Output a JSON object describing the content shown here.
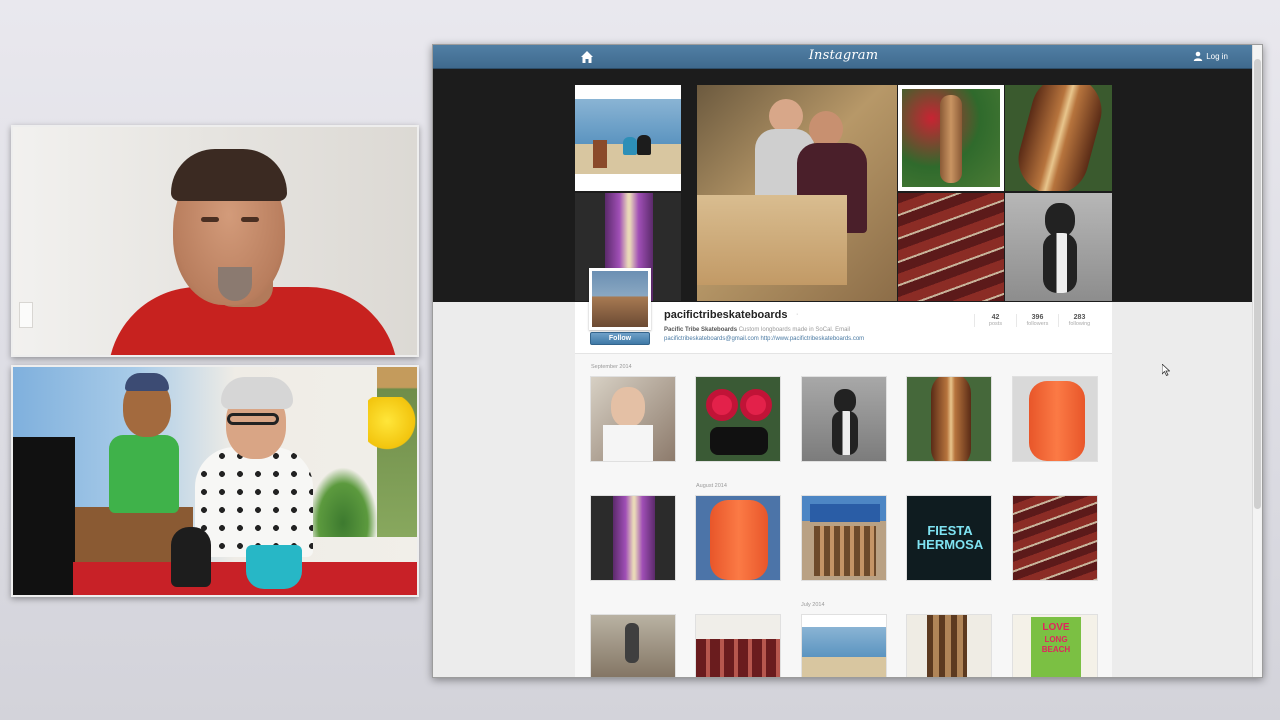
{
  "header": {
    "logo": "Instagram",
    "login_label": "Log in"
  },
  "profile": {
    "username": "pacifictribeskateboards",
    "verified_mark": "·",
    "bio_name": "Pacific Tribe Skateboards",
    "bio_text": "Custom longboards made in SoCal. Email",
    "bio_email": "pacifictribeskateboards@gmail.com",
    "bio_url": "http://www.pacifictribeskateboards.com",
    "follow_label": "Follow",
    "stats": [
      {
        "num": "42",
        "label": "posts"
      },
      {
        "num": "396",
        "label": "followers"
      },
      {
        "num": "283",
        "label": "following"
      }
    ]
  },
  "sections": {
    "sep": "September 2014",
    "aug": "August 2014",
    "jul": "July 2014"
  },
  "hero_tiles": [
    "beach-couple-photo",
    "woodshop-workers-photo",
    "longboard-roses-photo",
    "wood-longboard-photo",
    "purple-longboard-photo",
    "skateboard-pile-photo",
    "cat-on-board-photo"
  ],
  "grid_sep": [
    "old-man-photo",
    "red-wheels-photo",
    "cat-photo",
    "wood-deck-photo",
    "orange-board-photo"
  ],
  "grid_aug": [
    "purple-deck-photo",
    "orange-deck-photo",
    "booth-photo",
    "fiesta-hermosa-photo",
    "board-pile-photo"
  ],
  "grid_aug_text": {
    "fiesta_line1": "FIESTA",
    "fiesta_line2": "HERMOSA"
  },
  "grid_jul": [
    "skater-beach-photo",
    "red-boards-photo",
    "beach-photo",
    "workshop-photo",
    "love-beach-poster-photo"
  ],
  "grid_jul_text": {
    "love_line1": "LOVE",
    "love_line2": "LONG",
    "love_line3": "BEACH"
  },
  "colors": {
    "header_blue": "#3f6a8e",
    "follow_blue": "#3f79a6",
    "shirt_red": "#c7221f"
  }
}
